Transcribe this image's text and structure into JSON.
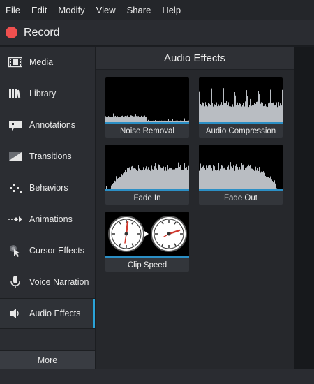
{
  "menu": {
    "items": [
      {
        "label": "File"
      },
      {
        "label": "Edit"
      },
      {
        "label": "Modify"
      },
      {
        "label": "View"
      },
      {
        "label": "Share"
      },
      {
        "label": "Help"
      }
    ]
  },
  "record": {
    "label": "Record",
    "color": "#f0504f"
  },
  "sidebar": {
    "items": [
      {
        "label": "Media",
        "icon": "film-strip-icon"
      },
      {
        "label": "Library",
        "icon": "books-icon"
      },
      {
        "label": "Annotations",
        "icon": "speech-bubble-icon"
      },
      {
        "label": "Transitions",
        "icon": "transition-icon"
      },
      {
        "label": "Behaviors",
        "icon": "behaviors-icon"
      },
      {
        "label": "Animations",
        "icon": "animation-arrow-icon"
      },
      {
        "label": "Cursor Effects",
        "icon": "cursor-effects-icon"
      },
      {
        "label": "Voice Narration",
        "icon": "microphone-icon"
      },
      {
        "label": "Audio Effects",
        "icon": "speaker-icon"
      }
    ],
    "active_index": 8,
    "more_label": "More",
    "accent": "#2aa3d8"
  },
  "panel": {
    "title": "Audio Effects",
    "tiles": [
      {
        "label": "Noise Removal",
        "icon": "noise-removal-waveform-icon"
      },
      {
        "label": "Audio Compression",
        "icon": "audio-compression-waveform-icon"
      },
      {
        "label": "Fade In",
        "icon": "fade-in-waveform-icon"
      },
      {
        "label": "Fade Out",
        "icon": "fade-out-waveform-icon"
      },
      {
        "label": "Clip Speed",
        "icon": "clip-speed-clocks-icon"
      }
    ]
  }
}
